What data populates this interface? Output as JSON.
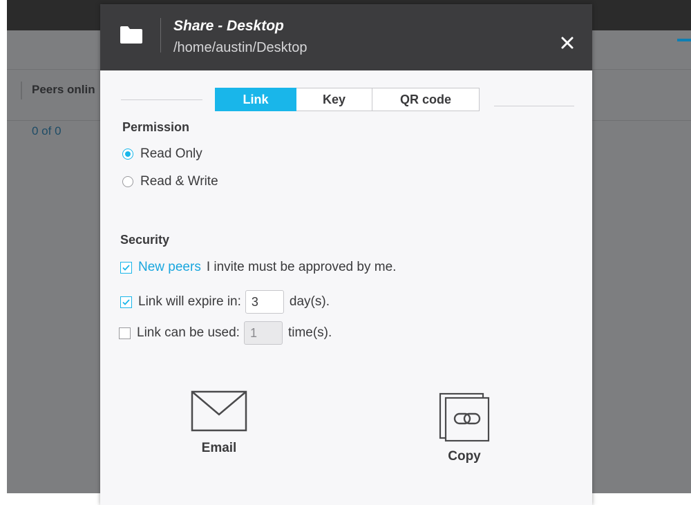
{
  "background": {
    "column_header": "Peers onlin",
    "peer_count": "0 of 0"
  },
  "dialog": {
    "title": "Share - Desktop",
    "path": "/home/austin/Desktop",
    "close_icon": "close-icon",
    "folder_icon": "folder-icon",
    "tabs": [
      {
        "label": "Link",
        "active": true
      },
      {
        "label": "Key",
        "active": false
      },
      {
        "label": "QR code",
        "active": false
      }
    ],
    "permission": {
      "title": "Permission",
      "options": [
        {
          "label": "Read Only",
          "selected": true
        },
        {
          "label": "Read & Write",
          "selected": false
        }
      ]
    },
    "security": {
      "title": "Security",
      "new_peers": {
        "checked": true,
        "link": "New peers",
        "text": "I invite must be approved by me."
      },
      "expire": {
        "checked": true,
        "label": "Link will expire in:",
        "value": "3",
        "unit": "day(s)."
      },
      "uses": {
        "checked": false,
        "label": "Link can be used:",
        "value": "1",
        "unit": "time(s)."
      }
    },
    "actions": [
      {
        "label": "Email",
        "icon": "envelope-icon"
      },
      {
        "label": "Copy",
        "icon": "copy-link-icon"
      }
    ]
  },
  "colors": {
    "accent": "#19b6ea",
    "header_bg": "#3c3c3e",
    "dim_bg": "#7d7e80"
  }
}
